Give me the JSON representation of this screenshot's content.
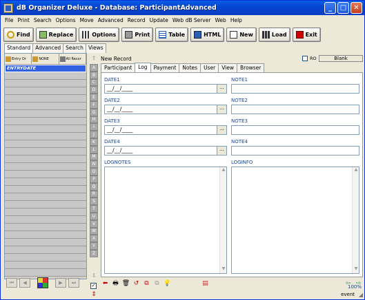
{
  "window": {
    "title": "dB Organizer Deluxe - Database: ParticipantAdvanced",
    "controls": [
      "_",
      "□",
      "✕"
    ]
  },
  "menu": [
    "File",
    "Print",
    "Search",
    "Options",
    "Move",
    "Advanced",
    "Record",
    "Update",
    "Web dB Server",
    "Web",
    "Help"
  ],
  "toolbar": [
    {
      "label": "Find",
      "icon": "find-icon",
      "color": "#c8a000"
    },
    {
      "label": "Replace",
      "icon": "replace-icon",
      "color": "#6a3"
    },
    {
      "label": "Options",
      "icon": "options-icon",
      "color": "#333"
    },
    {
      "label": "Print",
      "icon": "print-icon",
      "color": "#666"
    },
    {
      "label": "Table",
      "icon": "table-icon",
      "color": "#2b5fb4"
    },
    {
      "label": "HTML",
      "icon": "html-icon",
      "color": "#2b5fb4"
    },
    {
      "label": "New",
      "icon": "new-icon",
      "color": "#ddd"
    },
    {
      "label": "Load",
      "icon": "load-icon",
      "color": "#333"
    },
    {
      "label": "Exit",
      "icon": "exit-icon",
      "color": "#c00"
    }
  ],
  "left": {
    "tabs": [
      "Standard",
      "Advanced",
      "Search",
      "Views"
    ],
    "active_tab": "Standard",
    "buttons": [
      "Entry Or",
      "NONE",
      "All Recor"
    ],
    "selected_field": "ENTRYDATE",
    "empty_rows": 27
  },
  "letters": [
    "A",
    "B",
    "C",
    "D",
    "E",
    "F",
    "G",
    "H",
    "I",
    "J",
    "K",
    "L",
    "M",
    "N",
    "O",
    "P",
    "Q",
    "R",
    "S",
    "T",
    "U",
    "V",
    "W",
    "X",
    "Y",
    "Z"
  ],
  "record": {
    "label": "New Record",
    "ro_label": "RO",
    "blank_label": "Blank"
  },
  "right": {
    "tabs": [
      "Participant",
      "Log",
      "Payment",
      "Notes",
      "User",
      "View",
      "Browser"
    ],
    "active_tab": "Log",
    "date_labels": [
      "DATE1",
      "DATE2",
      "DATE3",
      "DATE4"
    ],
    "note_labels": [
      "NOTE1",
      "NOTE2",
      "NOTE3",
      "NOTE4"
    ],
    "date_value": "__/__/____",
    "lognotes_label": "LOGNOTES",
    "loginfo_label": "LOGINFO",
    "dots": "..."
  },
  "status": {
    "zoom": "100%",
    "event": "event"
  }
}
